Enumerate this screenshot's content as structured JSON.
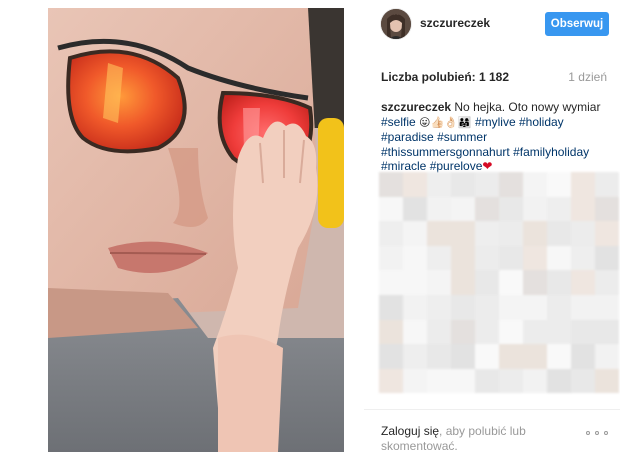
{
  "post": {
    "username": "szczureczek",
    "follow_label": "Obserwuj",
    "likes_label": "Liczba polubień: 1 182",
    "time": "1 dzień",
    "caption": {
      "username": "szczureczek",
      "text": "No hejka. Oto nowy wymiar",
      "line2_tag": "#selfie",
      "line2_emoji": "😛👍🏻👌🏻👨‍👩‍👧",
      "line2_tag2": "#mylive",
      "line2_tag3": "#holiday",
      "line3_tag1": "#paradise",
      "line3_tag2": "#summer",
      "line4_tag1": "#thissummersgonnahurt",
      "line4_tag2": "#familyholiday",
      "line5_tag1": "#miracle",
      "line5_tag2": "#purelove",
      "heart": "❤"
    },
    "footer": {
      "login_link": "Zaloguj się",
      "login_rest": ", aby polubić lub skomentować."
    }
  },
  "icons": {
    "more": "more-options-icon",
    "heart": "heart-emoji-icon"
  },
  "colors": {
    "follow_button": "#3897f0",
    "hashtag": "#003569",
    "muted_text": "#999999",
    "heart": "#d60b26"
  }
}
